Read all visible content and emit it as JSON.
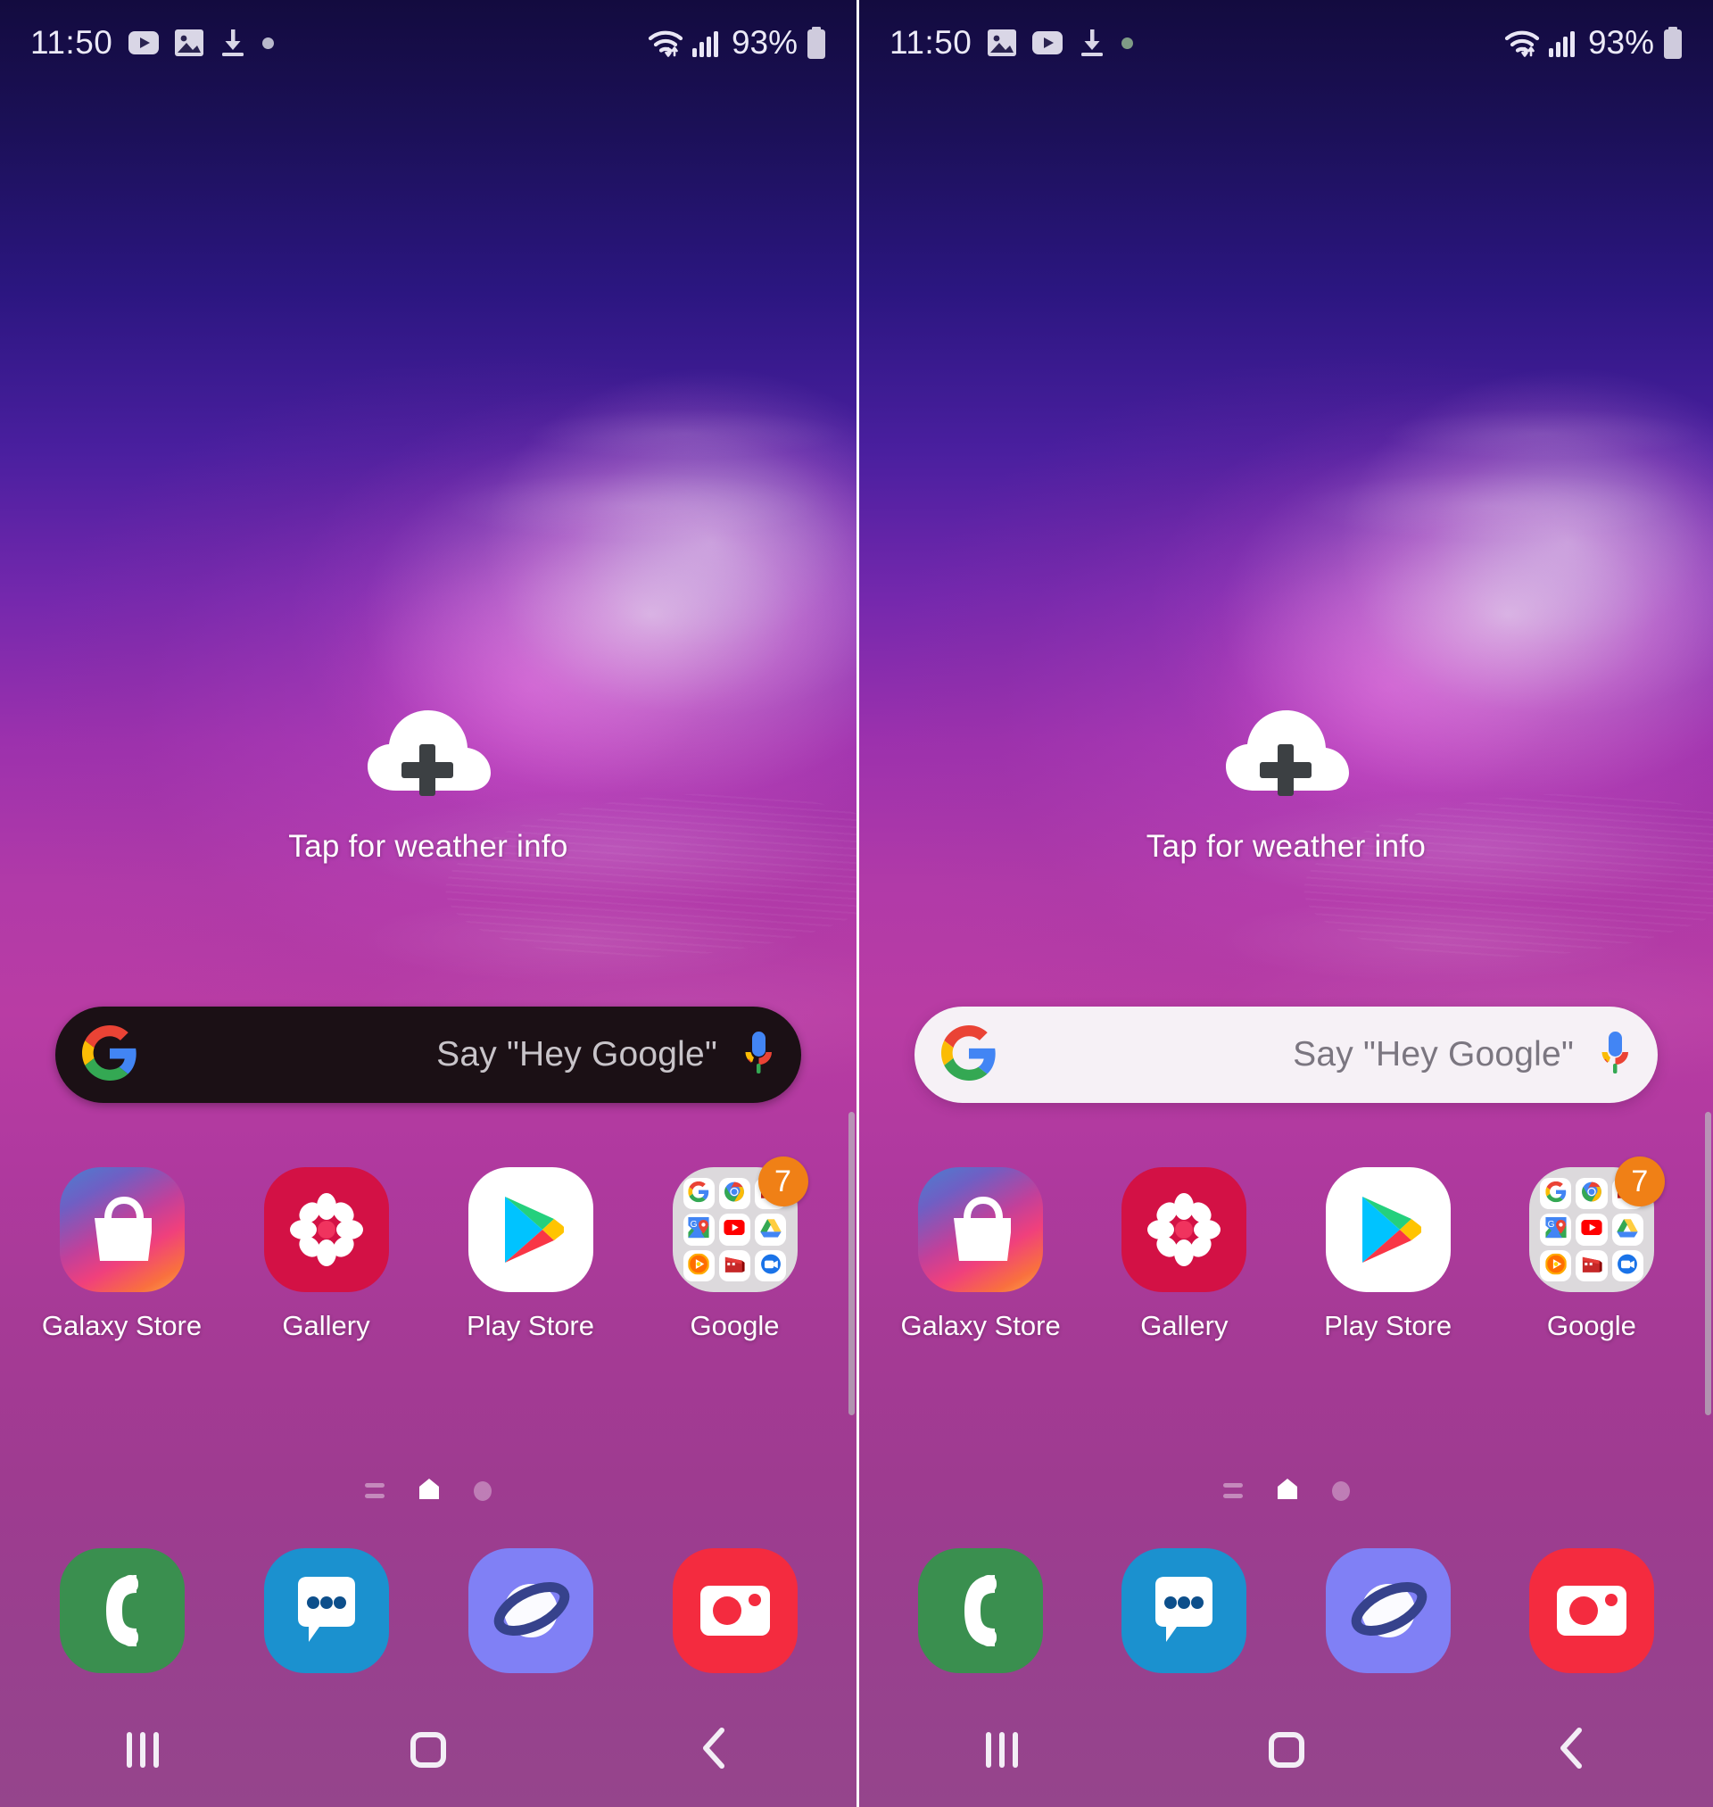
{
  "panels": [
    {
      "id": "left-panel",
      "theme": "dark-search",
      "status_bar": {
        "time": "11:50",
        "left_icons": [
          "youtube-icon",
          "image-icon",
          "download-icon",
          "dot-icon"
        ],
        "right_icons": [
          "wifi-icon",
          "signal-icon"
        ],
        "battery_percent": "93%",
        "battery_icon": "battery-icon"
      },
      "weather_widget": {
        "icon": "cloud-plus-icon",
        "label": "Tap for weather info"
      },
      "search_bar": {
        "logo": "google-g-icon",
        "placeholder": "Say \"Hey Google\"",
        "mic_icon": "assistant-mic-icon",
        "background": "#1b1015",
        "text_color": "#c8c4c9"
      },
      "apps": [
        {
          "label": "Galaxy Store",
          "icon": "galaxy-store-icon"
        },
        {
          "label": "Gallery",
          "icon": "gallery-icon"
        },
        {
          "label": "Play Store",
          "icon": "play-store-icon"
        },
        {
          "label": "Google",
          "icon": "google-folder-icon",
          "badge": "7"
        }
      ],
      "page_indicator": {
        "items": [
          "lines-icon",
          "home-icon",
          "dot-icon"
        ],
        "active": 1
      },
      "dock": [
        {
          "label": "Phone",
          "icon": "phone-icon"
        },
        {
          "label": "Messages",
          "icon": "messages-icon"
        },
        {
          "label": "Internet",
          "icon": "internet-icon"
        },
        {
          "label": "Camera",
          "icon": "camera-icon"
        }
      ],
      "nav_bar": {
        "recents": "recents-icon",
        "home": "home-square-icon",
        "back": "back-chevron-icon"
      }
    },
    {
      "id": "right-panel",
      "theme": "light-search",
      "status_bar": {
        "time": "11:50",
        "left_icons": [
          "image-icon",
          "youtube-icon",
          "download-icon",
          "dot-icon"
        ],
        "right_icons": [
          "wifi-icon",
          "signal-icon"
        ],
        "battery_percent": "93%",
        "battery_icon": "battery-icon"
      },
      "weather_widget": {
        "icon": "cloud-plus-icon",
        "label": "Tap for weather info"
      },
      "search_bar": {
        "logo": "google-g-icon",
        "placeholder": "Say \"Hey Google\"",
        "mic_icon": "assistant-mic-icon",
        "background": "#f6f1f6",
        "text_color": "#7b7680"
      },
      "apps": [
        {
          "label": "Galaxy Store",
          "icon": "galaxy-store-icon"
        },
        {
          "label": "Gallery",
          "icon": "gallery-icon"
        },
        {
          "label": "Play Store",
          "icon": "play-store-icon"
        },
        {
          "label": "Google",
          "icon": "google-folder-icon",
          "badge": "7"
        }
      ],
      "page_indicator": {
        "items": [
          "lines-icon",
          "home-icon",
          "dot-icon"
        ],
        "active": 1
      },
      "dock": [
        {
          "label": "Phone",
          "icon": "phone-icon"
        },
        {
          "label": "Messages",
          "icon": "messages-icon"
        },
        {
          "label": "Internet",
          "icon": "internet-icon"
        },
        {
          "label": "Camera",
          "icon": "camera-icon"
        }
      ],
      "nav_bar": {
        "recents": "recents-icon",
        "home": "home-square-icon",
        "back": "back-chevron-icon"
      }
    }
  ],
  "folder_contents": [
    "google-icon",
    "chrome-icon",
    "gmail-icon",
    "maps-icon",
    "youtube-icon",
    "drive-icon",
    "play-music-icon",
    "play-movies-icon",
    "duo-icon"
  ],
  "colors": {
    "accent_orange": "#f08016",
    "gallery_red": "#d31145",
    "phone_green": "#3a8f4f",
    "messages_blue": "#1b91cf",
    "internet_purple": "#8080f5",
    "camera_red": "#f42b3f",
    "folder_gray": "#dcd9dc",
    "nav_white": "#f3eef6"
  }
}
